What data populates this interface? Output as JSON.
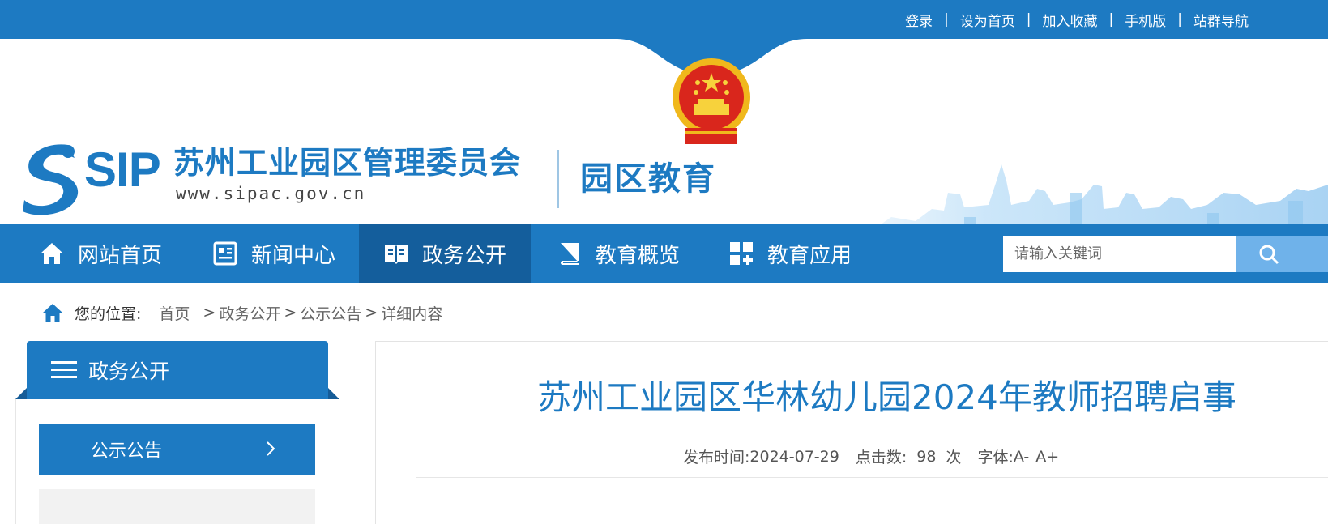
{
  "topbar": {
    "links": [
      "登录",
      "设为首页",
      "加入收藏",
      "手机版",
      "站群导航"
    ],
    "separator": "|"
  },
  "header": {
    "logo_text": "SIP",
    "org_name": "苏州工业园区管理委员会",
    "url": "www.sipac.gov.cn",
    "site_name": "园区教育"
  },
  "nav": {
    "items": [
      {
        "label": "网站首页",
        "icon": "home-icon"
      },
      {
        "label": "新闻中心",
        "icon": "news-icon"
      },
      {
        "label": "政务公开",
        "icon": "book-open-icon",
        "active": true
      },
      {
        "label": "教育概览",
        "icon": "book-icon"
      },
      {
        "label": "教育应用",
        "icon": "apps-icon"
      }
    ],
    "search_placeholder": "请输入关键词"
  },
  "breadcrumb": {
    "prefix": "您的位置:",
    "items": [
      "首页",
      "政务公开",
      "公示公告",
      "详细内容"
    ],
    "arrow": ">"
  },
  "sidebar": {
    "title": "政务公开",
    "items": [
      {
        "label": "公示公告",
        "active": true
      }
    ]
  },
  "article": {
    "title": "苏州工业园区华林幼儿园2024年教师招聘启事",
    "publish_label": "发布时间:",
    "publish_date": "2024-07-29",
    "clicks_label": "点击数:",
    "clicks_value": "98",
    "clicks_unit": "次",
    "font_label": "字体:",
    "font_smaller": "A-",
    "font_larger": "A+"
  },
  "colors": {
    "primary": "#1d7ac2",
    "active_nav": "#145e9c",
    "search_button": "#6fb2ea"
  }
}
